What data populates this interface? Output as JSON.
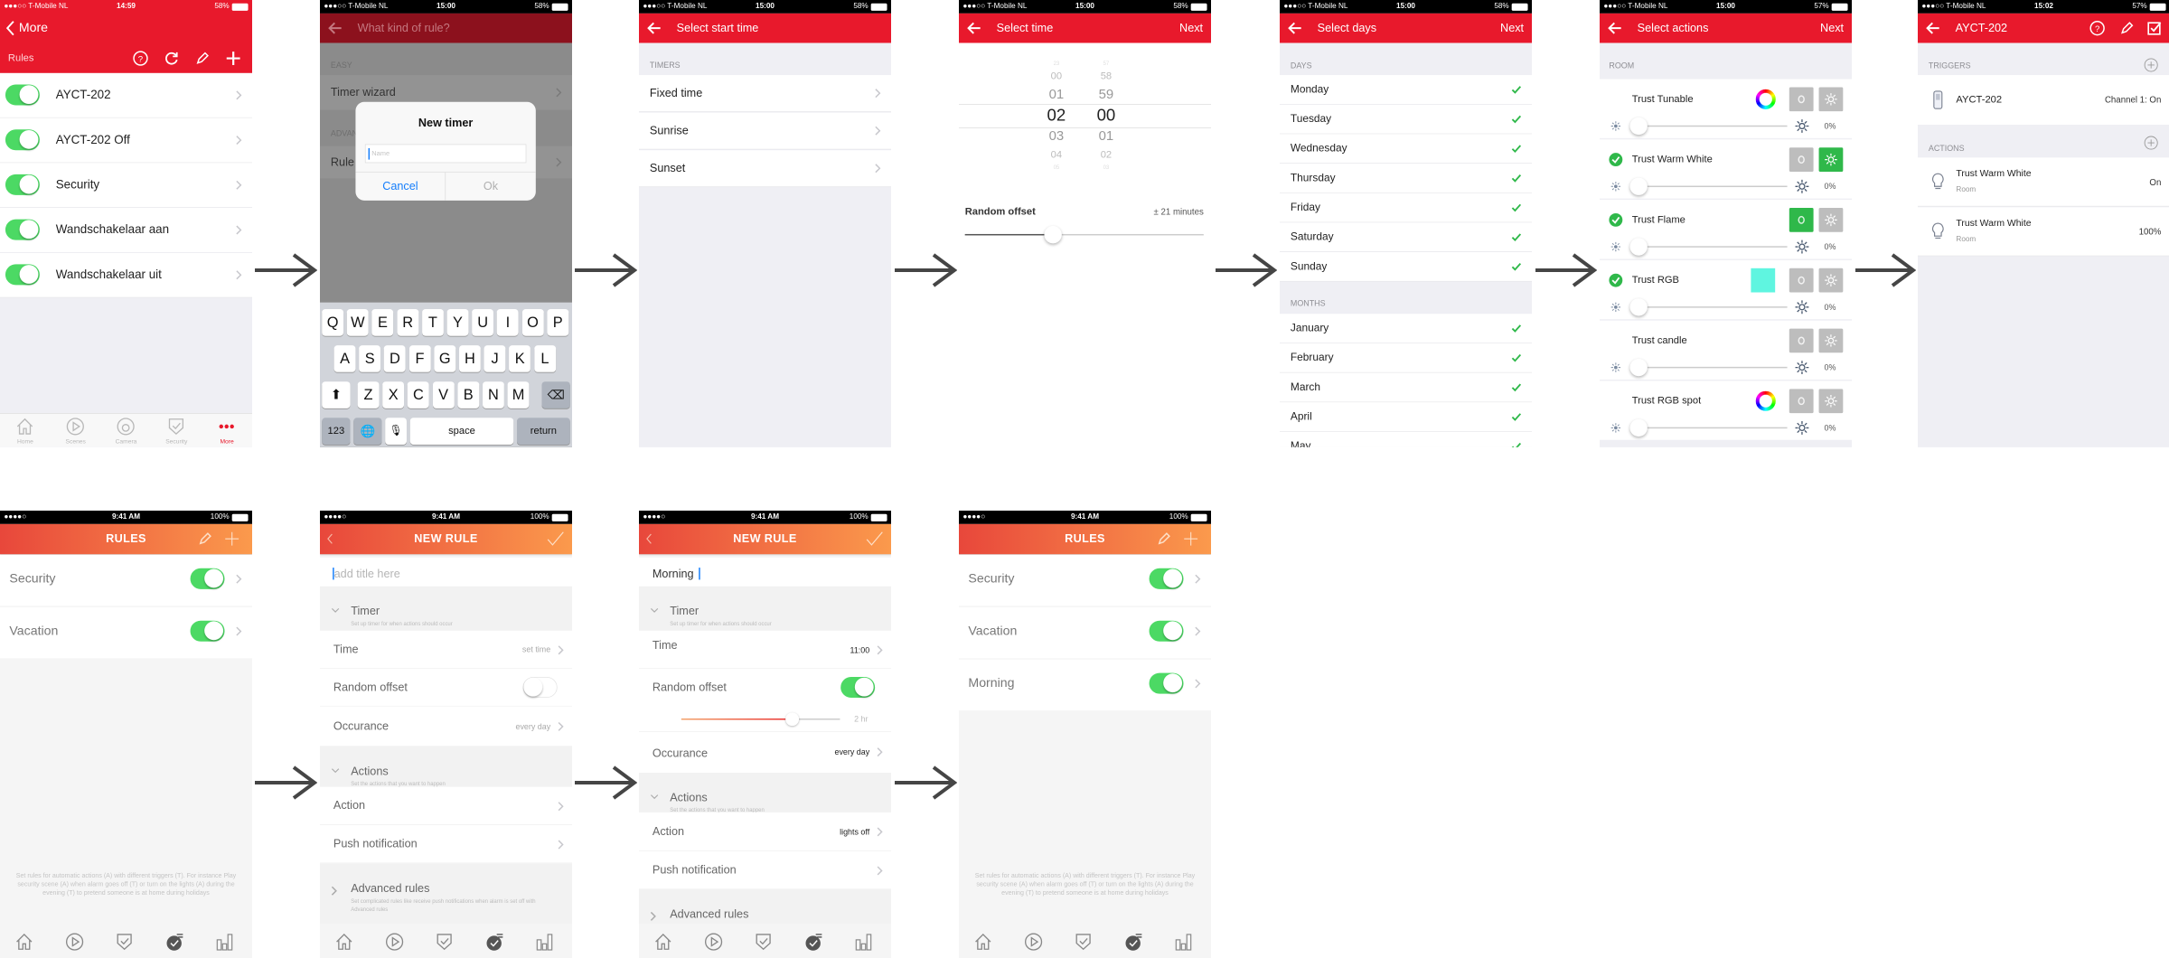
{
  "colors": {
    "brand_red": "#e8192c",
    "toggle_green": "#4cd964",
    "check_green": "#2fb84a",
    "gradient_start": "#e8473b",
    "gradient_end": "#fb9a4c",
    "ios_blue": "#157efb",
    "rgb_swatch": "#5ff5e0"
  },
  "s1": {
    "status": {
      "carrier": "●●●○○ T-Mobile NL",
      "time": "14:59",
      "battery": "58%"
    },
    "back_label": "More",
    "section_title": "Rules",
    "rules": [
      {
        "name": "AYCT-202",
        "enabled": true
      },
      {
        "name": "AYCT-202 Off",
        "enabled": true
      },
      {
        "name": "Security",
        "enabled": true
      },
      {
        "name": "Wandschakelaar aan",
        "enabled": true
      },
      {
        "name": "Wandschakelaar uit",
        "enabled": true
      }
    ],
    "tabs": [
      {
        "label": "Home",
        "icon": "home-icon"
      },
      {
        "label": "Scenes",
        "icon": "play-icon"
      },
      {
        "label": "Camera",
        "icon": "camera-icon"
      },
      {
        "label": "Security",
        "icon": "shield-icon"
      },
      {
        "label": "More",
        "icon": "more-dots-icon",
        "active": true
      }
    ]
  },
  "s2": {
    "status": {
      "carrier": "●●●○○ T-Mobile NL",
      "time": "15:00",
      "battery": "58%"
    },
    "title": "What kind of rule?",
    "easy_header": "EASY",
    "easy_item": "Timer wizard",
    "advanced_header": "ADVANCED",
    "advanced_item": "Rule",
    "dialog": {
      "title": "New timer",
      "placeholder": "Name",
      "cancel": "Cancel",
      "ok": "Ok"
    },
    "keyboard": {
      "row1": [
        "Q",
        "W",
        "E",
        "R",
        "T",
        "Y",
        "U",
        "I",
        "O",
        "P"
      ],
      "row2": [
        "A",
        "S",
        "D",
        "F",
        "G",
        "H",
        "J",
        "K",
        "L"
      ],
      "row3": [
        "Z",
        "X",
        "C",
        "V",
        "B",
        "N",
        "M"
      ],
      "numbers": "123",
      "space": "space",
      "return": "return"
    }
  },
  "s3": {
    "status": {
      "carrier": "●●●○○ T-Mobile NL",
      "time": "15:00",
      "battery": "58%"
    },
    "title": "Select start time",
    "header": "TIMERS",
    "items": [
      "Fixed time",
      "Sunrise",
      "Sunset"
    ]
  },
  "s4": {
    "status": {
      "carrier": "●●●○○ T-Mobile NL",
      "time": "15:00",
      "battery": "58%"
    },
    "title": "Select time",
    "next": "Next",
    "hours": [
      "23",
      "00",
      "01",
      "02",
      "03",
      "04",
      "05"
    ],
    "minutes": [
      "57",
      "58",
      "59",
      "00",
      "01",
      "02",
      "03"
    ],
    "offset_label": "Random offset",
    "offset_value": "± 21 minutes",
    "offset_fraction": 0.37
  },
  "s5": {
    "status": {
      "carrier": "●●●○○ T-Mobile NL",
      "time": "15:00",
      "battery": "58%"
    },
    "title": "Select days",
    "next": "Next",
    "days_header": "DAYS",
    "days": [
      "Monday",
      "Tuesday",
      "Wednesday",
      "Thursday",
      "Friday",
      "Saturday",
      "Sunday"
    ],
    "months_header": "MONTHS",
    "months": [
      "January",
      "February",
      "March",
      "April",
      "May"
    ]
  },
  "s6": {
    "status": {
      "carrier": "●●●○○ T-Mobile NL",
      "time": "15:00",
      "battery": "57%"
    },
    "title": "Select actions",
    "next": "Next",
    "room_header": "ROOM",
    "devices": [
      {
        "name": "Trust Tunable",
        "selected": false,
        "color_control": "wheel",
        "power_on": false,
        "brightness_on": false,
        "level": "0%"
      },
      {
        "name": "Trust Warm White",
        "selected": true,
        "color_control": "none",
        "power_on": false,
        "brightness_on": true,
        "level": "0%"
      },
      {
        "name": "Trust Flame",
        "selected": true,
        "color_control": "none",
        "power_on": true,
        "brightness_on": false,
        "level": "0%"
      },
      {
        "name": "Trust RGB",
        "selected": true,
        "color_control": "swatch",
        "power_on": false,
        "brightness_on": false,
        "level": "0%"
      },
      {
        "name": "Trust candle",
        "selected": false,
        "color_control": "none",
        "power_on": false,
        "brightness_on": false,
        "level": "0%"
      },
      {
        "name": "Trust RGB spot",
        "selected": false,
        "color_control": "wheel",
        "power_on": false,
        "brightness_on": false,
        "level": "0%"
      }
    ]
  },
  "s7": {
    "status": {
      "carrier": "●●●○○ T-Mobile NL",
      "time": "15:02",
      "battery": "57%"
    },
    "title": "AYCT-202",
    "triggers_header": "TRIGGERS",
    "trigger": {
      "name": "AYCT-202",
      "value": "Channel 1: On"
    },
    "actions_header": "ACTIONS",
    "actions": [
      {
        "name": "Trust Warm White",
        "room": "Room",
        "value": "On"
      },
      {
        "name": "Trust Warm White",
        "room": "Room",
        "value": "100%"
      }
    ]
  },
  "s8": {
    "status": {
      "carrier": "●●●●○",
      "time": "9:41 AM",
      "battery": "100%"
    },
    "title": "RULES",
    "rules": [
      {
        "name": "Security",
        "enabled": true
      },
      {
        "name": "Vacation",
        "enabled": true
      }
    ],
    "help": "Set rules for automatic actions (A) with different triggers (T). For instance Play security scene (A) when alarm goes off (T) or turn on the lights (A) during the evening (T) to pretend someone is at home during holidays"
  },
  "s9": {
    "status": {
      "carrier": "●●●●○",
      "time": "9:41 AM",
      "battery": "100%"
    },
    "title": "NEW RULE",
    "title_placeholder": "add title here",
    "timer": {
      "title": "Timer",
      "subtitle": "Set up timer for when actions should occur"
    },
    "time_label": "Time",
    "time_value": "set time",
    "offset_label": "Random offset",
    "offset_on": false,
    "occurance_label": "Occurance",
    "occurance_value": "every day",
    "actions": {
      "title": "Actions",
      "subtitle": "Set the actions that you want to happen"
    },
    "action_label": "Action",
    "push_label": "Push notification",
    "advanced": {
      "title": "Advanced rules",
      "subtitle": "Set complicated rules like receive push notifications when alarm is set off with Advanced rules"
    }
  },
  "s10": {
    "status": {
      "carrier": "●●●●○",
      "time": "9:41 AM",
      "battery": "100%"
    },
    "title": "NEW RULE",
    "title_value": "Morning",
    "timer": {
      "title": "Timer",
      "subtitle": "Set up timer for when actions should occur"
    },
    "time_label": "Time",
    "time_value": "11:00",
    "offset_label": "Random offset",
    "offset_on": true,
    "offset_fraction": 0.7,
    "offset_value": "2 hr",
    "occurance_label": "Occurance",
    "occurance_value": "every day",
    "actions": {
      "title": "Actions",
      "subtitle": "Set the actions that you want to happen"
    },
    "action_label": "Action",
    "action_value": "lights off",
    "push_label": "Push notification",
    "advanced": {
      "title": "Advanced rules"
    }
  },
  "s11": {
    "status": {
      "carrier": "●●●●○",
      "time": "9:41 AM",
      "battery": "100%"
    },
    "title": "RULES",
    "rules": [
      {
        "name": "Security",
        "enabled": true
      },
      {
        "name": "Vacation",
        "enabled": true
      },
      {
        "name": "Morning",
        "enabled": true
      }
    ],
    "help": "Set rules for automatic actions (A) with different triggers (T). For instance Play security scene (A) when alarm goes off (T) or turn on the lights (A) during the evening (T) to pretend someone is at home during holidays"
  }
}
